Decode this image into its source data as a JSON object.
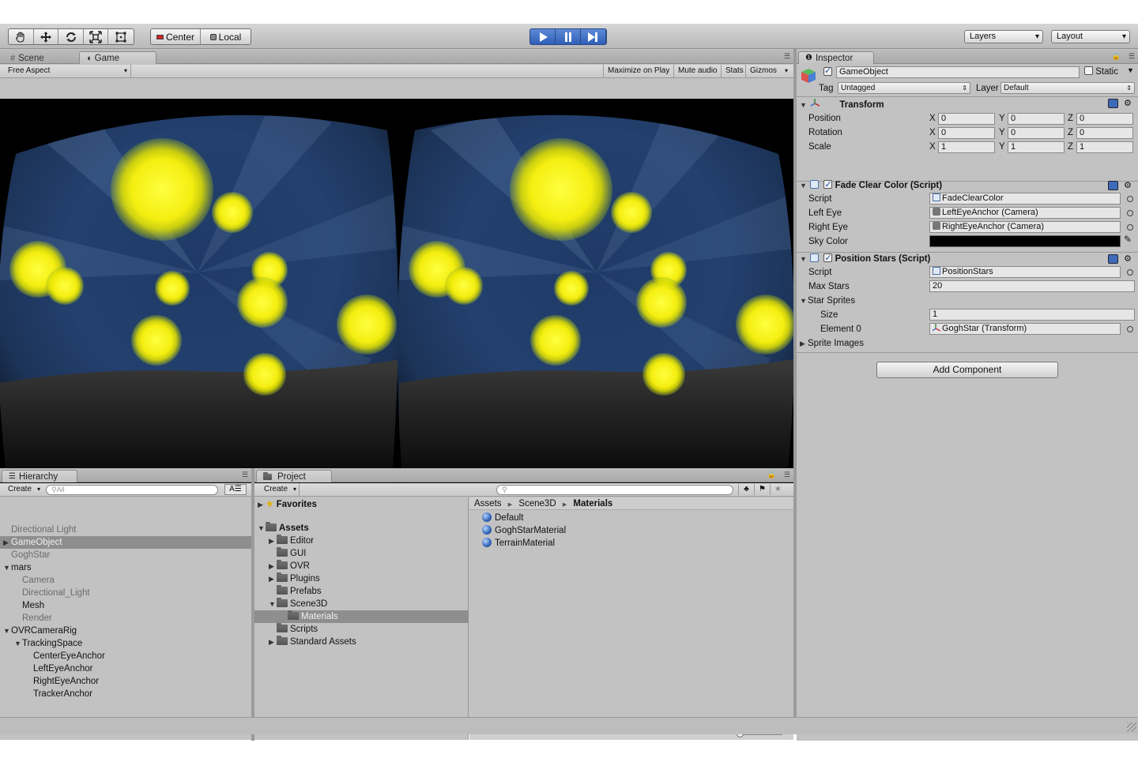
{
  "toolbar": {
    "tools": [
      "hand-tool",
      "move-tool",
      "rotate-tool",
      "scale-tool",
      "rect-tool"
    ],
    "pivot_center": "Center",
    "pivot_local": "Local",
    "layers": "Layers",
    "layout": "Layout"
  },
  "scene_tabs": {
    "scene": "Scene",
    "game": "Game"
  },
  "game_bar": {
    "aspect": "Free Aspect",
    "maximize": "Maximize on Play",
    "mute": "Mute audio",
    "stats": "Stats",
    "gizmos": "Gizmos"
  },
  "hierarchy": {
    "tab": "Hierarchy",
    "create": "Create",
    "search_placeholder": "All",
    "items": [
      {
        "label": "Directional Light",
        "style": "grey",
        "indent": 0,
        "arrow": ""
      },
      {
        "label": "GameObject",
        "style": "selected",
        "indent": 0,
        "arrow": "right"
      },
      {
        "label": "GoghStar",
        "style": "grey",
        "indent": 0,
        "arrow": ""
      },
      {
        "label": "mars",
        "style": "normal",
        "indent": 0,
        "arrow": "down"
      },
      {
        "label": "Camera",
        "style": "grey",
        "indent": 1,
        "arrow": ""
      },
      {
        "label": "Directional_Light",
        "style": "grey",
        "indent": 1,
        "arrow": ""
      },
      {
        "label": "Mesh",
        "style": "normal",
        "indent": 1,
        "arrow": ""
      },
      {
        "label": "Render",
        "style": "grey",
        "indent": 1,
        "arrow": ""
      },
      {
        "label": "OVRCameraRig",
        "style": "normal",
        "indent": 0,
        "arrow": "down"
      },
      {
        "label": "TrackingSpace",
        "style": "normal",
        "indent": 1,
        "arrow": "down"
      },
      {
        "label": "CenterEyeAnchor",
        "style": "normal",
        "indent": 2,
        "arrow": ""
      },
      {
        "label": "LeftEyeAnchor",
        "style": "normal",
        "indent": 2,
        "arrow": ""
      },
      {
        "label": "RightEyeAnchor",
        "style": "normal",
        "indent": 2,
        "arrow": ""
      },
      {
        "label": "TrackerAnchor",
        "style": "normal",
        "indent": 2,
        "arrow": ""
      }
    ]
  },
  "project": {
    "tab": "Project",
    "create": "Create",
    "favorites": "Favorites",
    "assets": "Assets",
    "folders": [
      {
        "label": "Editor",
        "arrow": "right",
        "indent": 1
      },
      {
        "label": "GUI",
        "arrow": "",
        "indent": 1
      },
      {
        "label": "OVR",
        "arrow": "right",
        "indent": 1
      },
      {
        "label": "Plugins",
        "arrow": "right",
        "indent": 1
      },
      {
        "label": "Prefabs",
        "arrow": "",
        "indent": 1
      },
      {
        "label": "Scene3D",
        "arrow": "down",
        "indent": 1
      },
      {
        "label": "Materials",
        "arrow": "",
        "indent": 2,
        "selected": true
      },
      {
        "label": "Scripts",
        "arrow": "",
        "indent": 1
      },
      {
        "label": "Standard Assets",
        "arrow": "right",
        "indent": 1
      }
    ],
    "breadcrumb": [
      "Assets",
      "Scene3D",
      "Materials"
    ],
    "files": [
      "Default",
      "GoghStarMaterial",
      "TerrainMaterial"
    ]
  },
  "inspector": {
    "tab": "Inspector",
    "object_name": "GameObject",
    "static_label": "Static",
    "tag_label": "Tag",
    "tag_value": "Untagged",
    "layer_label": "Layer",
    "layer_value": "Default",
    "transform": {
      "title": "Transform",
      "rows": [
        {
          "label": "Position",
          "x": "0",
          "y": "0",
          "z": "0"
        },
        {
          "label": "Rotation",
          "x": "0",
          "y": "0",
          "z": "0"
        },
        {
          "label": "Scale",
          "x": "1",
          "y": "1",
          "z": "1"
        }
      ],
      "axis": {
        "x": "X",
        "y": "Y",
        "z": "Z"
      }
    },
    "fade": {
      "title": "Fade Clear Color (Script)",
      "script_label": "Script",
      "script_value": "FadeClearColor",
      "left_label": "Left Eye",
      "left_value": "LeftEyeAnchor (Camera)",
      "right_label": "Right Eye",
      "right_value": "RightEyeAnchor (Camera)",
      "sky_label": "Sky Color",
      "sky_color": "#000000"
    },
    "stars": {
      "title": "Position Stars (Script)",
      "script_label": "Script",
      "script_value": "PositionStars",
      "max_label": "Max Stars",
      "max_value": "20",
      "sprites_label": "Star Sprites",
      "size_label": "Size",
      "size_value": "1",
      "element_label": "Element 0",
      "element_value": "GoghStar (Transform)",
      "images_label": "Sprite Images"
    },
    "add_component": "Add Component"
  },
  "colors": {
    "play_blue": "#3a6cc7",
    "selection": "#8e8e8e",
    "star": "#ffff20"
  }
}
